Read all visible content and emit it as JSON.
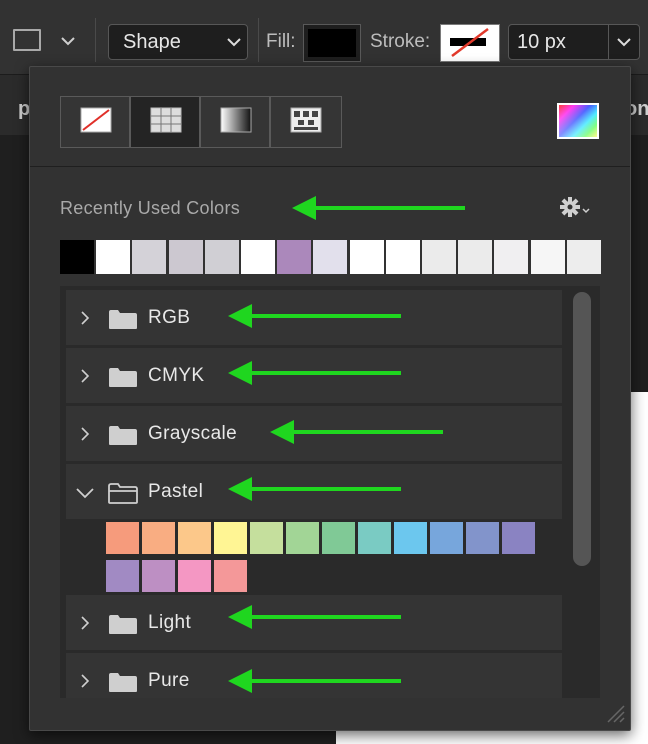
{
  "toolbar": {
    "mode_value": "Shape",
    "fill_label": "Fill:",
    "stroke_label": "Stroke:",
    "size_value": "10 px"
  },
  "background": {
    "left_letter": "p",
    "right_letters": "on"
  },
  "panel": {
    "type_buttons": [
      "no-color",
      "color-swatches",
      "gradient",
      "pattern"
    ],
    "recent_title": "Recently Used Colors",
    "recent_colors": [
      "#000000",
      "#ffffff",
      "#d4d2d8",
      "#ccc8d0",
      "#d0cfd4",
      "#ffffff",
      "#ab88bb",
      "#e2e0ec",
      "#ffffff",
      "#ffffff",
      "#ebebeb",
      "#ebebeb",
      "#f0eff1",
      "#f6f6f6",
      "#ededed"
    ],
    "groups": [
      {
        "name": "RGB",
        "expanded": false
      },
      {
        "name": "CMYK",
        "expanded": false
      },
      {
        "name": "Grayscale",
        "expanded": false
      },
      {
        "name": "Pastel",
        "expanded": true
      },
      {
        "name": "Light",
        "expanded": false
      },
      {
        "name": "Pure",
        "expanded": false
      }
    ],
    "pastel_colors": [
      "#f69b7c",
      "#f9ad82",
      "#fcc88a",
      "#fff594",
      "#c5df9d",
      "#a2d596",
      "#80c996",
      "#7acbc3",
      "#6cc7ee",
      "#77a6dc",
      "#8294cb",
      "#8a83c2",
      "#a18ac3",
      "#bd8fc3",
      "#f497c3",
      "#f49899"
    ]
  },
  "annotation": {
    "arrow_color": "#1fd61f"
  }
}
